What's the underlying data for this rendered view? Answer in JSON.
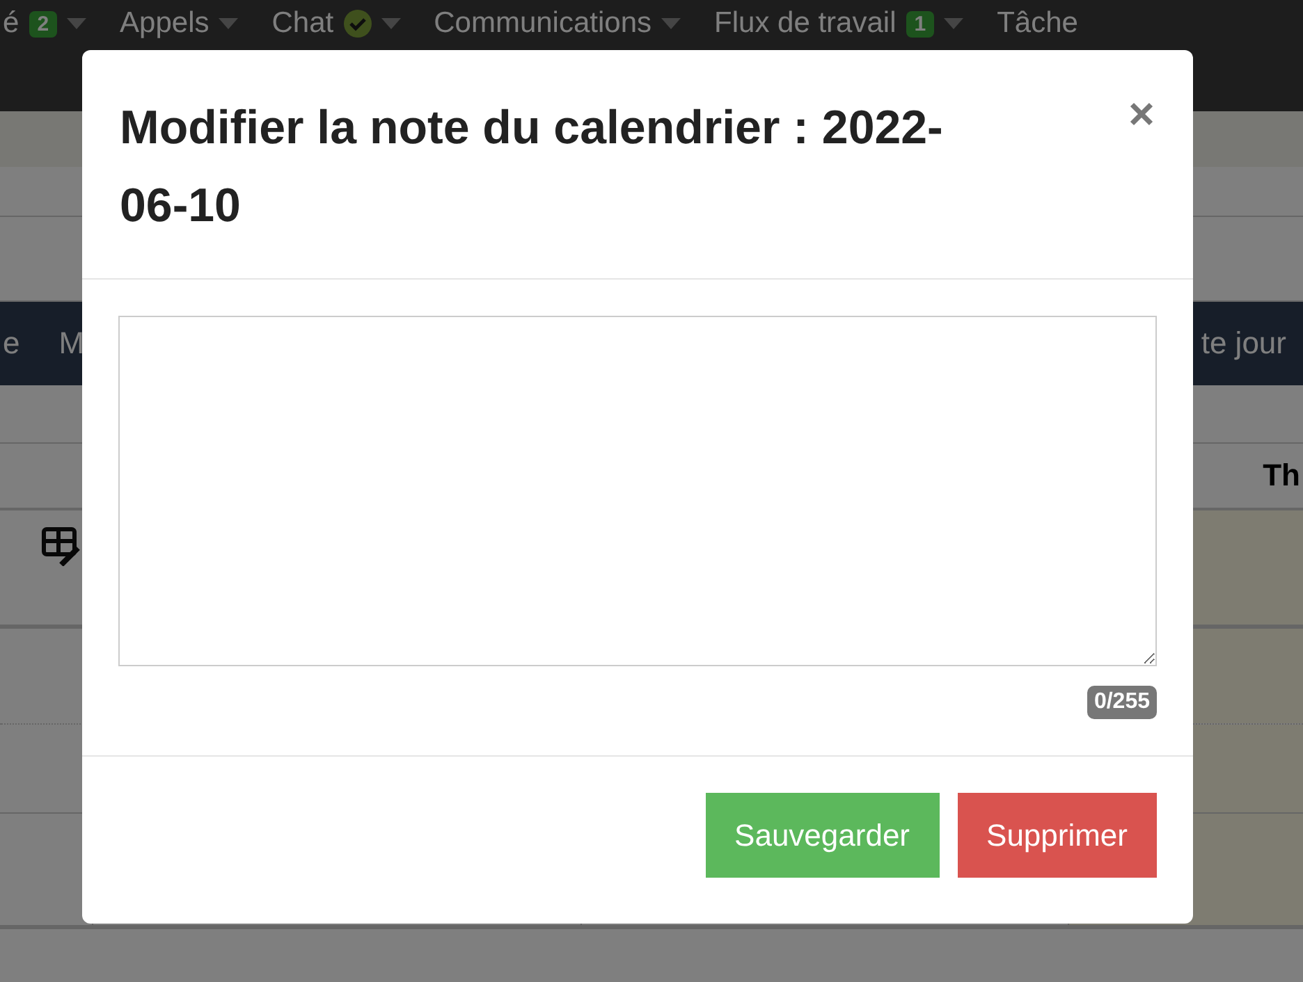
{
  "nav": {
    "items": [
      {
        "label": "é",
        "badge": "2",
        "check": false
      },
      {
        "label": "Appels",
        "check": false
      },
      {
        "label": "Chat",
        "check": true
      },
      {
        "label": "Communications",
        "check": false
      },
      {
        "label": "Flux de travail",
        "badge": "1",
        "check": false
      },
      {
        "label": "Tâche",
        "caret": false
      }
    ]
  },
  "toolbar": {
    "items": [
      "e",
      "M",
      "te jour"
    ]
  },
  "calendar": {
    "header": "Th"
  },
  "modal": {
    "title": "Modifier la note du calendrier : 2022-06-10",
    "counter": "0/255",
    "buttons": [
      {
        "label": "Sauvegarder",
        "kind": "save"
      },
      {
        "label": "Supprimer",
        "kind": "delete"
      }
    ]
  }
}
